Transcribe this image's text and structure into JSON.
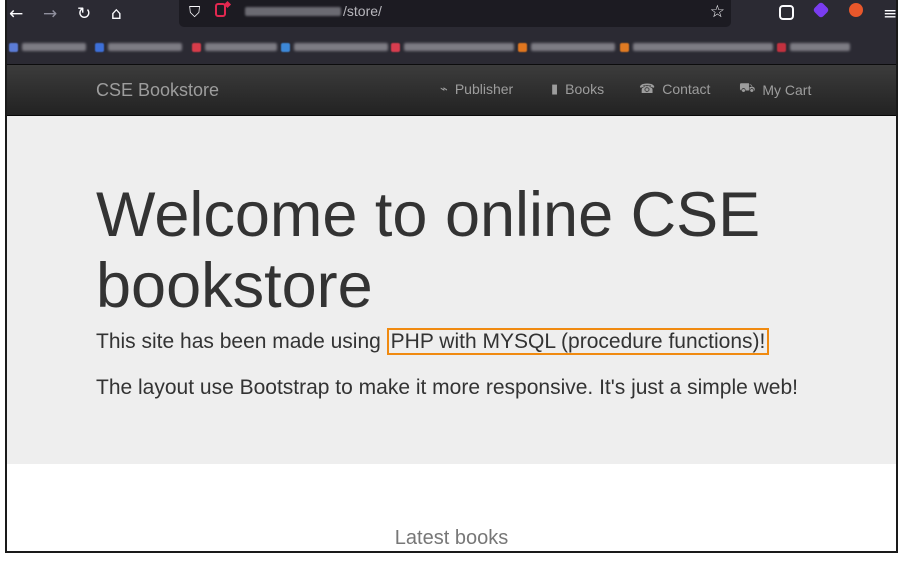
{
  "browser": {
    "url_path": "/store/",
    "back_icon": "arrow-left",
    "forward_icon": "arrow-right",
    "reload_icon": "reload",
    "home_icon": "home",
    "bookmark_star_icon": "star",
    "menu_icon": "hamburger"
  },
  "navbar": {
    "brand": "CSE Bookstore",
    "items": [
      {
        "label": "Publisher",
        "icon": "paperclip"
      },
      {
        "label": "Books",
        "icon": "book"
      },
      {
        "label": "Contact",
        "icon": "phone"
      },
      {
        "label": "My Cart",
        "icon": "cart"
      }
    ]
  },
  "jumbotron": {
    "title": "Welcome to online CSE bookstore",
    "lead_prefix": "This site has been made using ",
    "lead_highlight": "PHP with MYSQL (procedure functions)!",
    "lead2": "The layout use Bootstrap to make it more responsive. It's just a simple web!"
  },
  "latest": {
    "heading": "Latest books"
  },
  "colors": {
    "navbar_bg": "#222222",
    "jumbotron_bg": "#eeeeee",
    "highlight_border": "#f08a10",
    "nav_text": "#9d9d9d"
  }
}
